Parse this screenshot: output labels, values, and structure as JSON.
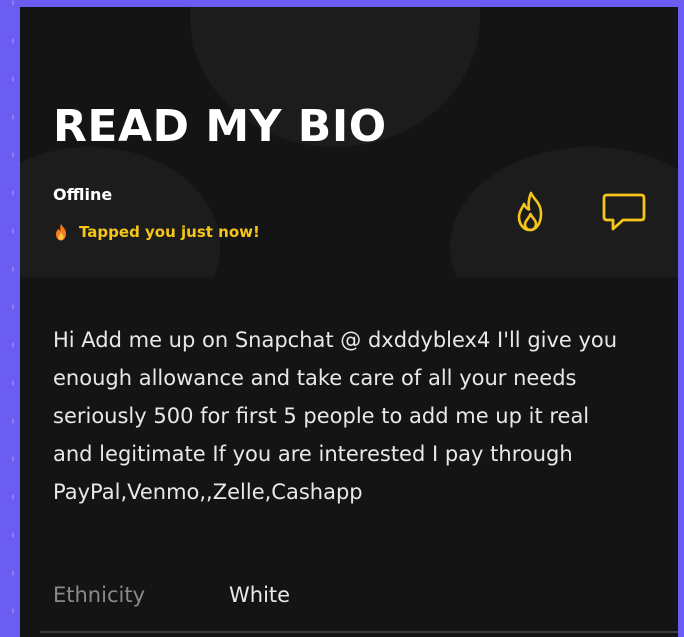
{
  "profile": {
    "name": "READ MY BIO",
    "status": "Offline",
    "tapped": "Tapped you just now!"
  },
  "bio": {
    "lines": [
      "Hi Add me up on Snapchat @ dxddyblex4 I'll give you",
      "enough allowance and take care of all your needs",
      "seriously 500 for first 5 people to add me up it real",
      "and legitimate If you are interested I pay through",
      "PayPal,Venmo,,Zelle,Cashapp"
    ]
  },
  "attributes": [
    {
      "label": "Ethnicity",
      "value": "White"
    }
  ],
  "icons": {
    "tap": "fire-icon",
    "chat": "chat-bubble-icon"
  },
  "colors": {
    "accent": "#f5c518",
    "background": "#141414",
    "frame": "#6b5cf2"
  }
}
